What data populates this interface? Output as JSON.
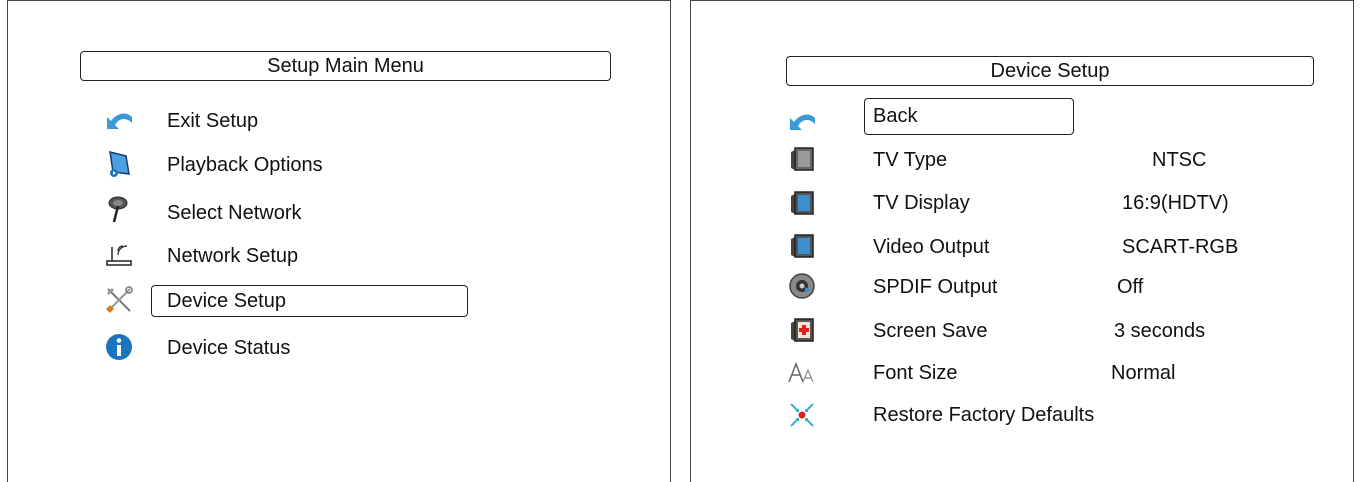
{
  "main_menu": {
    "title": "Setup Main Menu",
    "items": [
      {
        "label": "Exit Setup",
        "icon": "back-arrow-icon"
      },
      {
        "label": "Playback Options",
        "icon": "playback-icon"
      },
      {
        "label": "Select Network",
        "icon": "antenna-icon"
      },
      {
        "label": "Network Setup",
        "icon": "router-icon"
      },
      {
        "label": "Device Setup",
        "icon": "tools-icon",
        "selected": true
      },
      {
        "label": "Device Status",
        "icon": "info-icon"
      }
    ]
  },
  "device_setup": {
    "title": "Device Setup",
    "items": [
      {
        "label": "Back",
        "value": "",
        "icon": "back-arrow-icon",
        "selected": true
      },
      {
        "label": "TV Type",
        "value": "NTSC",
        "icon": "tv-icon"
      },
      {
        "label": "TV Display",
        "value": "16:9(HDTV)",
        "icon": "tv-display-icon"
      },
      {
        "label": "Video Output",
        "value": "SCART-RGB",
        "icon": "video-output-icon"
      },
      {
        "label": "SPDIF Output",
        "value": "Off",
        "icon": "disc-icon"
      },
      {
        "label": "Screen Save",
        "value": "3 seconds",
        "icon": "screensaver-icon"
      },
      {
        "label": "Font Size",
        "value": "Normal",
        "icon": "font-size-icon"
      },
      {
        "label": "Restore Factory Defaults",
        "value": "",
        "icon": "restore-icon"
      }
    ]
  },
  "colors": {
    "accent_blue": "#1b75bc",
    "arrow_blue": "#3a9ad9",
    "restore_red": "#e02020"
  }
}
